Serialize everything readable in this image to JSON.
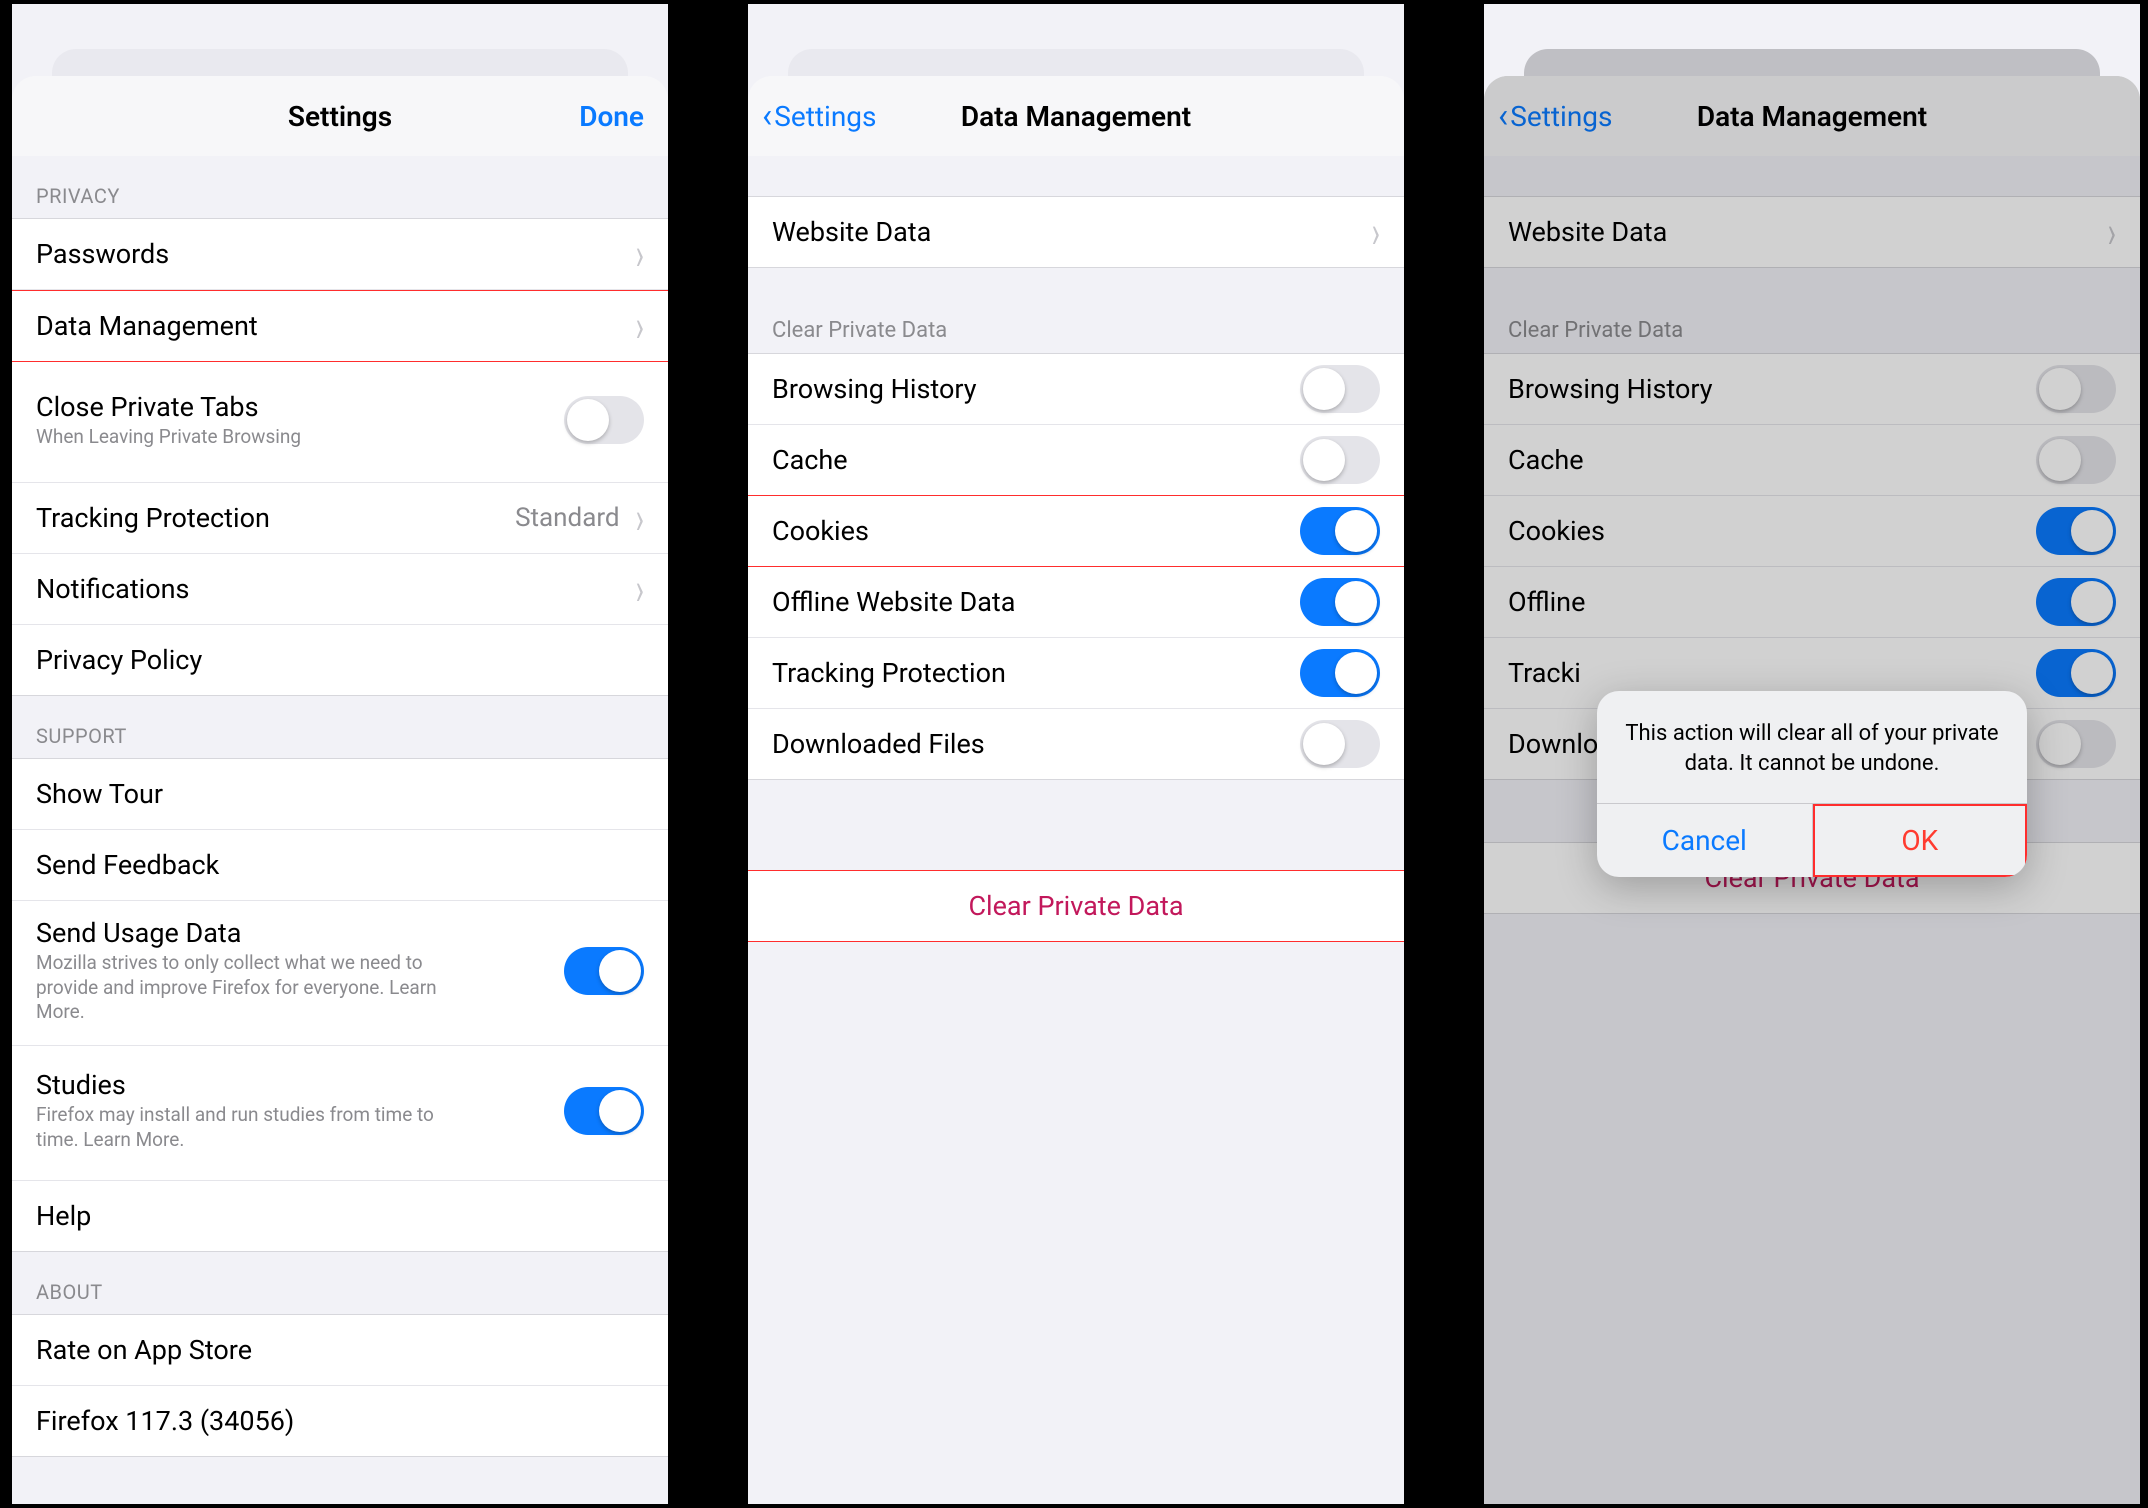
{
  "colors": {
    "accent": "#0a7aff",
    "destructive": "#c2185b",
    "alert_red": "#ff3b30"
  },
  "s1": {
    "nav": {
      "title": "Settings",
      "done": "Done"
    },
    "groups": [
      {
        "header": "PRIVACY",
        "rows": [
          {
            "label": "Passwords",
            "disclosure": true
          },
          {
            "label": "Data Management",
            "disclosure": true,
            "hl": true
          },
          {
            "label": "Close Private Tabs",
            "sub": "When Leaving Private Browsing",
            "switch": false
          },
          {
            "label": "Tracking Protection",
            "detail": "Standard",
            "disclosure": true
          },
          {
            "label": "Notifications",
            "disclosure": true
          },
          {
            "label": "Privacy Policy"
          }
        ]
      },
      {
        "header": "SUPPORT",
        "rows": [
          {
            "label": "Show Tour"
          },
          {
            "label": "Send Feedback"
          },
          {
            "label": "Send Usage Data",
            "sub": "Mozilla strives to only collect what we need to provide and improve Firefox for everyone. Learn More.",
            "switch": true
          },
          {
            "label": "Studies",
            "sub": "Firefox may install and run studies from time to time. Learn More.",
            "switch": true
          },
          {
            "label": "Help"
          }
        ]
      },
      {
        "header": "ABOUT",
        "rows": [
          {
            "label": "Rate on App Store"
          },
          {
            "label": "Firefox 117.3 (34056)"
          }
        ]
      }
    ]
  },
  "s2": {
    "nav": {
      "back": "Settings",
      "title": "Data Management"
    },
    "top": {
      "label": "Website Data",
      "disclosure": true
    },
    "section_header": "Clear Private Data",
    "toggles": [
      {
        "label": "Browsing History",
        "on": false
      },
      {
        "label": "Cache",
        "on": false,
        "hl_bottom": true
      },
      {
        "label": "Cookies",
        "on": true,
        "hl_bottom": true
      },
      {
        "label": "Offline Website Data",
        "on": true
      },
      {
        "label": "Tracking Protection",
        "on": true
      },
      {
        "label": "Downloaded Files",
        "on": false
      }
    ],
    "clear": {
      "label": "Clear Private Data"
    }
  },
  "s3": {
    "nav": {
      "back": "Settings",
      "title": "Data Management"
    },
    "top": {
      "label": "Website Data",
      "disclosure": true
    },
    "section_header": "Clear Private Data",
    "toggles": [
      {
        "label": "Browsing History",
        "on": false
      },
      {
        "label": "Cache",
        "on": false
      },
      {
        "label": "Cookies",
        "on": true
      },
      {
        "label": "Offline",
        "on": true
      },
      {
        "label": "Tracki",
        "on": true
      },
      {
        "label": "Downlo",
        "on": false
      }
    ],
    "clear": {
      "label": "Clear Private Data"
    },
    "alert": {
      "message": "This action will clear all of your private data. It cannot be undone.",
      "cancel": "Cancel",
      "ok": "OK"
    }
  }
}
